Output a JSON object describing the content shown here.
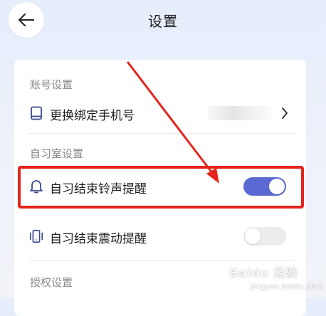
{
  "header": {
    "title": "设置",
    "back_icon": "arrow-left-icon"
  },
  "account_section": {
    "label": "账号设置",
    "rows": [
      {
        "label": "更换绑定手机号",
        "icon": "phone-icon",
        "value": "",
        "chevron_icon": "chevron-right-icon"
      }
    ]
  },
  "study_room_section": {
    "label": "自习室设置",
    "rows": [
      {
        "label": "自习结束铃声提醒",
        "icon": "bell-icon",
        "toggle_on": true
      },
      {
        "label": "自习结束震动提醒",
        "icon": "vibrate-icon",
        "toggle_on": false
      }
    ]
  },
  "auth_section": {
    "label": "授权设置"
  },
  "colors": {
    "accent": "#5b6ad3",
    "highlight": "#e6241c",
    "toggle_off": "#ececec"
  },
  "watermark": {
    "text": "Baidu 经验",
    "sub": "jingyan.baidu.com"
  }
}
